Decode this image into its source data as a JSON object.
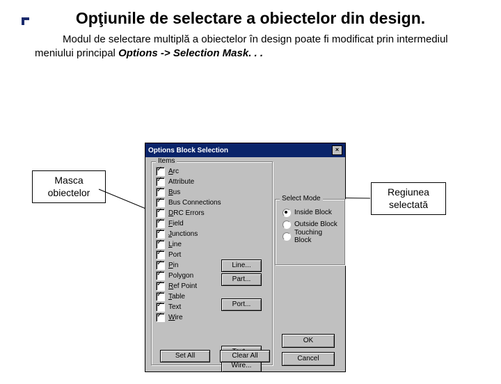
{
  "title": "Opţiunile de selectare a obiectelor din design.",
  "para_lead": "Modul de selectare multiplă a obiectelor în design poate fi modificat prin intermediul meniului principal ",
  "para_em": "Options -> Selection Mask. . .",
  "dialog": {
    "title": "Options Block Selection",
    "items_label": "Items",
    "mode_label": "Select Mode",
    "checks": [
      {
        "u": "A",
        "rest": "rc"
      },
      {
        "u": "",
        "rest": "Attribute"
      },
      {
        "u": "B",
        "rest": "us"
      },
      {
        "u": "",
        "rest": "Bus Connections"
      },
      {
        "u": "D",
        "rest": "RC Errors"
      },
      {
        "u": "F",
        "rest": "ield"
      },
      {
        "u": "J",
        "rest": "unctions"
      },
      {
        "u": "L",
        "rest": "ine"
      },
      {
        "u": "",
        "rest": "Port"
      },
      {
        "u": "P",
        "rest": "in"
      },
      {
        "u": "",
        "rest": "Polygon"
      },
      {
        "u": "R",
        "rest": "ef Point"
      },
      {
        "u": "T",
        "rest": "able"
      },
      {
        "u": "",
        "rest": "Text"
      },
      {
        "u": "W",
        "rest": "ire"
      }
    ],
    "side_buttons": [
      "Line...",
      "Part...",
      "",
      "Port...",
      "",
      "",
      "",
      "Text...",
      "Wire..."
    ],
    "bottom_buttons": [
      "Set All",
      "Clear All"
    ],
    "radios": [
      {
        "label": "Inside Block",
        "sel": true
      },
      {
        "label": "Outside Block",
        "sel": false
      },
      {
        "label": "Touching Block",
        "sel": false
      }
    ],
    "ok_buttons": [
      "OK",
      "Cancel"
    ]
  },
  "callouts": {
    "left": "Masca obiectelor",
    "right": "Regiunea selectată"
  }
}
